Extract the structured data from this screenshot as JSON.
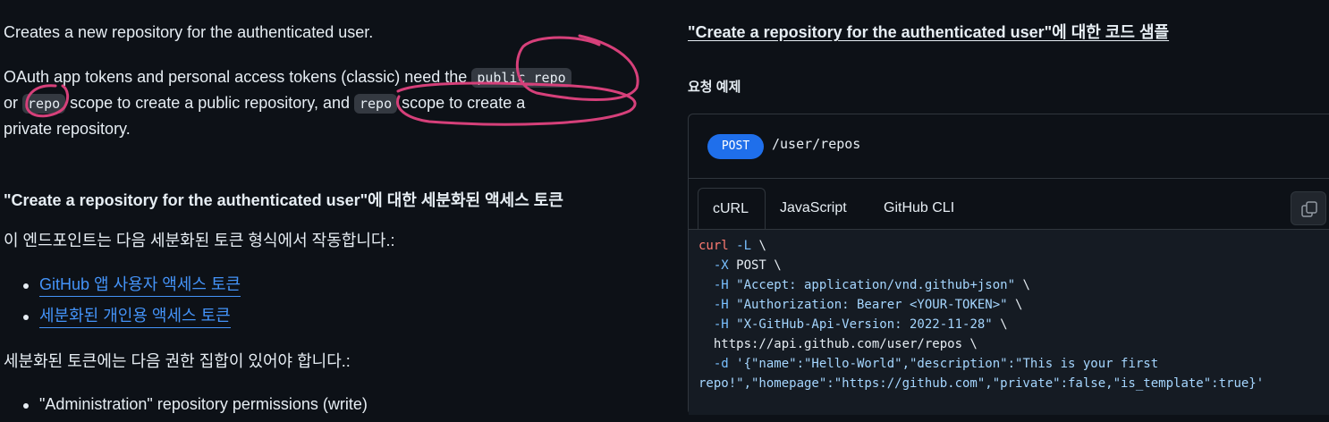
{
  "intro": {
    "line1": "Creates a new repository for the authenticated user.",
    "p2_a": "OAuth app tokens and personal access tokens (classic) need the ",
    "p2_code1": "public_repo",
    "p2_b": "or ",
    "p2_code2": "repo",
    "p2_c": " scope to create a public repository, and ",
    "p2_code3": "repo",
    "p2_d": " scope to create a",
    "p2_e": "private repository."
  },
  "fine_grained": {
    "heading": "\"Create a repository for the authenticated user\"에 대한 세분화된 액세스 토큰",
    "intro": "이 엔드포인트는 다음 세분화된 토큰 형식에서 작동합니다.:",
    "links": [
      "GitHub 앱 사용자 액세스 토큰",
      "세분화된 개인용 액세스 토큰"
    ],
    "perm_intro": "세분화된 토큰에는 다음 권한 집합이 있어야 합니다.:",
    "perms": [
      "\"Administration\" repository permissions (write)"
    ]
  },
  "code_samples": {
    "title": "\"Create a repository for the authenticated user\"에 대한 코드 샘플",
    "request_label": "요청 예제",
    "method": "POST",
    "path": "/user/repos",
    "tabs": [
      "cURL",
      "JavaScript",
      "GitHub CLI"
    ],
    "active_tab": "cURL",
    "copy_icon": "copy-icon",
    "code": {
      "l1_cmd": "curl",
      "l1_flag": " -L",
      "l1_rest": " \\",
      "l2_flag": "  -X",
      "l2_rest": " POST \\",
      "l3_flag": "  -H",
      "l3_str": " \"Accept: application/vnd.github+json\"",
      "l3_rest": " \\",
      "l4_flag": "  -H",
      "l4_str": " \"Authorization: Bearer <YOUR-TOKEN>\"",
      "l4_rest": " \\",
      "l5_flag": "  -H",
      "l5_str": " \"X-GitHub-Api-Version: 2022-11-28\"",
      "l5_rest": " \\",
      "l6": "  https://api.github.com/user/repos \\",
      "l7_flag": "  -d",
      "l7_str": " '{\"name\":\"Hello-World\",\"description\":\"This is your first",
      "l8_str": "repo!\",\"homepage\":\"https://github.com\",\"private\":false,\"is_template\":true}'"
    }
  },
  "colors": {
    "background": "#0d1117",
    "link": "#4493f8",
    "method_badge": "#1f6feb",
    "annotation_ink": "#d6407a"
  }
}
